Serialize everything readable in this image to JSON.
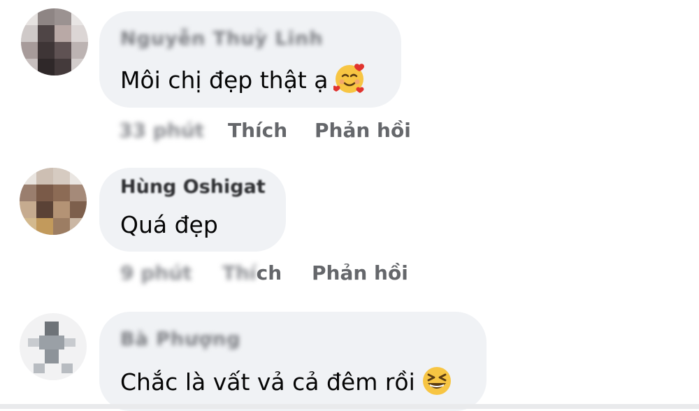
{
  "comments": [
    {
      "author": "Nguyễn Thuỳ Linh",
      "text": "Môi chị đẹp thật ạ",
      "emoji": "smiling-face-with-hearts",
      "time": "33 phút",
      "like": "Thích",
      "reply": "Phản hồi"
    },
    {
      "author": "Hùng Oshigat",
      "text": "Quá đẹp",
      "time": "9 phút",
      "like_blurred": "Thí",
      "like_visible": "ch",
      "reply": "Phản hồi"
    },
    {
      "author": "Bà Phượng",
      "text": "Chắc là vất vả cả đêm rồi",
      "emoji": "grinning-squinting-face"
    }
  ]
}
